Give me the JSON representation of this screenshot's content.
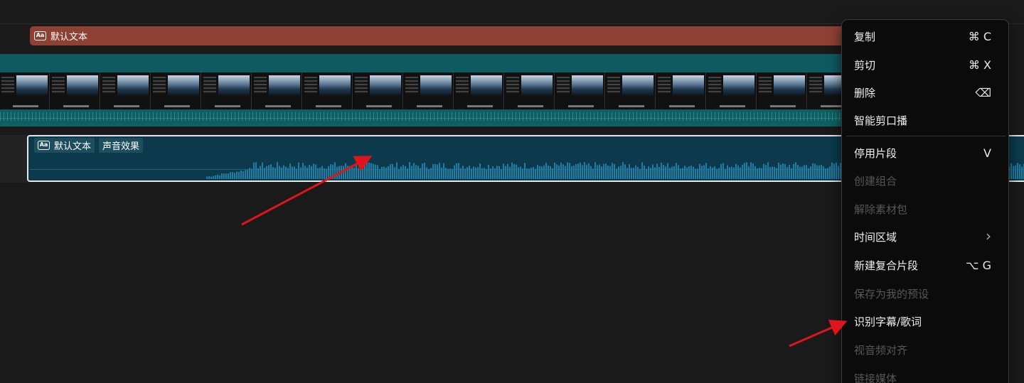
{
  "timeline": {
    "text_clip_label": "默认文本",
    "sfx_clip_labels": [
      "默认文本",
      "声音效果"
    ]
  },
  "context_menu": {
    "items": [
      {
        "label": "复制",
        "shortcut": "⌘  C",
        "enabled": true
      },
      {
        "label": "剪切",
        "shortcut": "⌘  X",
        "enabled": true
      },
      {
        "label": "删除",
        "shortcut": "⌫",
        "enabled": true
      },
      {
        "label": "智能剪口播",
        "shortcut": "",
        "enabled": true
      },
      {
        "label": "停用片段",
        "shortcut": "V",
        "enabled": true
      },
      {
        "label": "创建组合",
        "shortcut": "",
        "enabled": false
      },
      {
        "label": "解除素材包",
        "shortcut": "",
        "enabled": false
      },
      {
        "label": "时间区域",
        "shortcut": "›",
        "enabled": true
      },
      {
        "label": "新建复合片段",
        "shortcut": "⌥  G",
        "enabled": true
      },
      {
        "label": "保存为我的预设",
        "shortcut": "",
        "enabled": false
      },
      {
        "label": "识别字幕/歌词",
        "shortcut": "",
        "enabled": true
      },
      {
        "label": "视音频对齐",
        "shortcut": "",
        "enabled": false
      },
      {
        "label": "链接媒体",
        "shortcut": "",
        "enabled": false
      }
    ]
  },
  "colors": {
    "text_clip": "#8e4133",
    "video_track": "#0e5a60",
    "sfx_clip": "#0c3a4c",
    "arrow": "#e0151b"
  }
}
